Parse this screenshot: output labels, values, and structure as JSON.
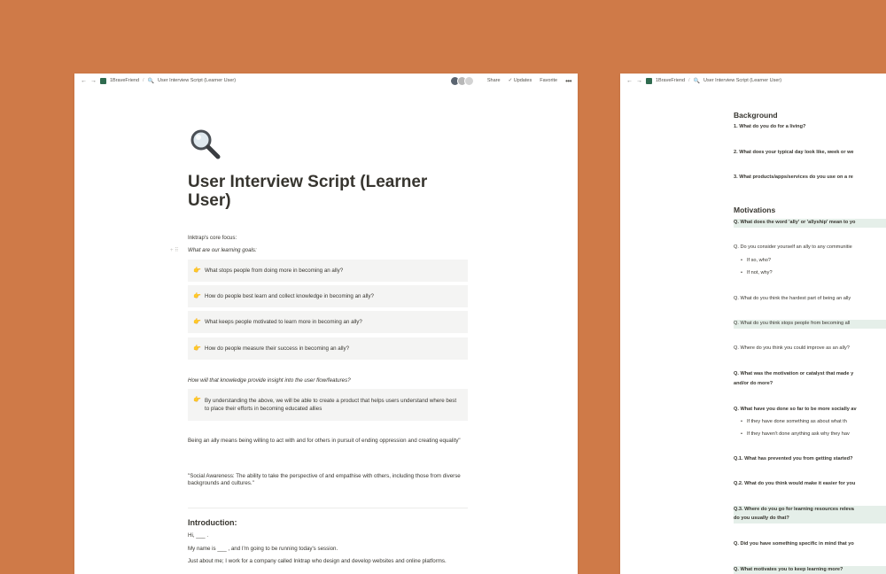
{
  "topbar": {
    "back": "←",
    "forward": "→",
    "workspace": "1BraveFriend",
    "separator": "/",
    "page": "User Interview Script (Learner User)",
    "share": "Share",
    "updates": "Updates",
    "favorite": "Favorite",
    "more": "•••",
    "update_check": "✓"
  },
  "doc": {
    "title": "User Interview Script (Learner User)",
    "core_focus_label": "Inktrap's core focus:",
    "learning_goals_label": "What are our learning goals:",
    "goals": [
      "What stops people from doing more in becoming an ally?",
      "How do people best learn and collect knowledge in becoming an ally?",
      "What keeps people motivated to learn more in becoming an ally?",
      "How do people measure their success in becoming an ally?"
    ],
    "knowledge_q": "How will that knowledge provide insight into the user flow/features?",
    "knowledge_callout": "By understanding the above, we will be able to create a product that helps users understand where best to place their efforts in becoming educated allies",
    "ally_definition": "Being an ally means being willing to act with and for others in pursuit of ending oppression and creating equality\"",
    "social_awareness": "\"Social Awareness: The ability to take the perspective of and empathise with others, including those from diverse backgrounds and cultures.\"",
    "intro_heading": "Introduction:",
    "intro_hi": "Hi, ___ .",
    "intro_name": "My name is ___ , and I'm going to be running today's session.",
    "intro_about": "Just about me; I work for a company called Inktrap who design and develop websites and online platforms."
  },
  "right_doc": {
    "background_heading": "Background",
    "bg_q1": "1. What do you do for a living?",
    "bg_q2": "2. What does your typical day look like, week or we",
    "bg_q3": "3. What products/apps/services do you use on a re",
    "motivations_heading": "Motivations",
    "m_q1": "Q. What does the word 'ally' or 'allyship' mean to yo",
    "m_q2": "Q. Do you consider yourself an ally to any communitie",
    "m_b1": "If so, who?",
    "m_b2": "If not, why?",
    "m_q3": "Q. What do you think the hardest part of being an ally",
    "m_q4": "Q. What do you think stops people from becoming all",
    "m_q5": "Q. Where do you think you could improve as an ally?",
    "m_q6a": "Q. What was the motivation or catalyst that made y",
    "m_q6b": "and/or do more?",
    "m_q7": "Q. What have you done so far to be more socially av",
    "m_b3": "If they have done something as about what th",
    "m_b4": "If they haven't done anything ask why they hav",
    "m_q8": "Q.1. What has prevented you from getting started?",
    "m_q9": "Q.2. What do you think would make it easier for you",
    "m_q10a": "Q.3. Where do you go for learning resources releva",
    "m_q10b": "do you usually do that?",
    "m_q11": "Q. Did you have something specific in mind that yo",
    "m_q12": "Q. What motivates you to keep learning more?"
  },
  "colors": {
    "background": "#CF7A48",
    "page": "#FFFFFF",
    "callout": "#F4F4F3",
    "highlight": "#E5EFE9"
  },
  "icons": [
    "back-arrow-icon",
    "forward-arrow-icon",
    "workspace-icon",
    "magnifier-icon",
    "hand-pointing-icon",
    "more-icon"
  ]
}
